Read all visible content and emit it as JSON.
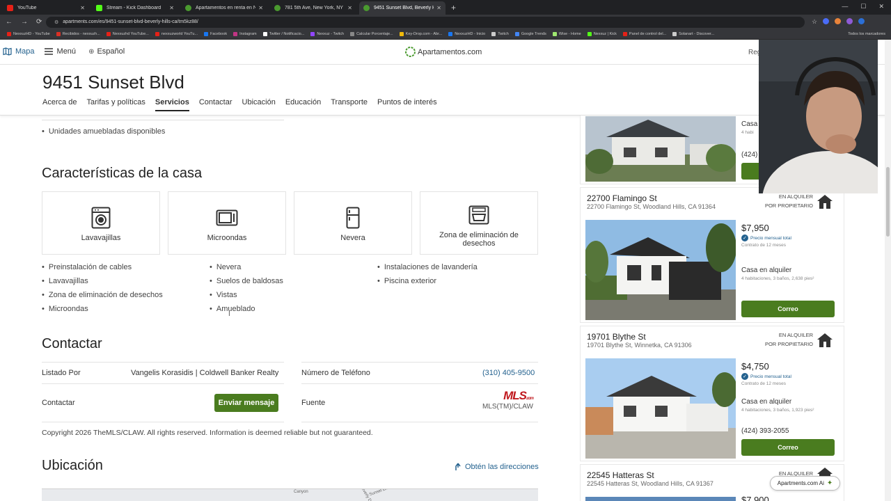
{
  "browser": {
    "tabs": [
      {
        "title": "YouTube",
        "color": "#e62117"
      },
      {
        "title": "Stream - Kick Dashboard",
        "color": "#53fc18"
      },
      {
        "title": "Apartamentos en renta en New",
        "color": "#4a9a2f"
      },
      {
        "title": "781 5th Ave, New York, NY 100",
        "color": "#4a9a2f"
      },
      {
        "title": "9451 Sunset Blvd, Beverly Hills",
        "color": "#4a9a2f",
        "active": true
      }
    ],
    "url": "apartments.com/es/9451-sunset-blvd-beverly-hills-ca/tm5kz88/",
    "bookmarks": [
      {
        "label": "NexxuzHD - YouTube",
        "color": "#e62117"
      },
      {
        "label": "Recibidos - nexxuzh...",
        "color": "#d93025"
      },
      {
        "label": "Nexxuzhd YouTube...",
        "color": "#e62117"
      },
      {
        "label": "nexxuzworld YouTu...",
        "color": "#e62117"
      },
      {
        "label": "Facebook",
        "color": "#1877f2"
      },
      {
        "label": "Instagram",
        "color": "#c13584"
      },
      {
        "label": "Twitter / Notificacio...",
        "color": "#ffffff"
      },
      {
        "label": "Nexxuz - Twitch",
        "color": "#9146ff"
      },
      {
        "label": "Calcular Porcentaje...",
        "color": "#888888"
      },
      {
        "label": "Key-Drop.com - Abr...",
        "color": "#f0b90b"
      },
      {
        "label": "NexxuzHD - Inicio",
        "color": "#1877f2"
      },
      {
        "label": "Twitch",
        "color": "#cccccc"
      },
      {
        "label": "Google Trends",
        "color": "#4285f4"
      },
      {
        "label": "Wise - Home",
        "color": "#9fe870"
      },
      {
        "label": "Nexxuz | Kick",
        "color": "#53fc18"
      },
      {
        "label": "Panel de control del...",
        "color": "#e62117"
      },
      {
        "label": "Solanart - Discover...",
        "color": "#cccccc"
      }
    ],
    "all_bookmarks": "Todos los marcadores"
  },
  "site_header": {
    "map_label": "Mapa",
    "menu_label": "Menú",
    "language_label": "Español",
    "logo_text": "Apartamentos.com",
    "right_text_1": "Reg",
    "right_text_2": "r"
  },
  "property": {
    "title": "9451 Sunset Blvd",
    "tabs": [
      "Acerca de",
      "Tarifas y políticas",
      "Servicios",
      "Contactar",
      "Ubicación",
      "Educación",
      "Transporte",
      "Puntos de interés"
    ],
    "active_tab": "Servicios"
  },
  "main": {
    "furnished_note": "Unidades amuebladas disponibles",
    "features_title": "Características de la casa",
    "feature_cards": [
      {
        "label": "Lavavajillas",
        "icon": "dishwasher-icon"
      },
      {
        "label": "Microondas",
        "icon": "microwave-icon"
      },
      {
        "label": "Nevera",
        "icon": "fridge-icon"
      },
      {
        "label": "Zona de eliminación de desechos",
        "icon": "disposal-icon"
      }
    ],
    "features_list": [
      [
        "Preinstalación de cables",
        "Lavavajillas",
        "Zona de eliminación de desechos",
        "Microondas"
      ],
      [
        "Nevera",
        "Suelos de baldosas",
        "Vistas",
        "Amueblado"
      ],
      [
        "Instalaciones de lavandería",
        "Piscina exterior"
      ]
    ],
    "contact_title": "Contactar",
    "listed_by_label": "Listado Por",
    "listed_by_value": "Vangelis Korasidis | Coldwell Banker Realty",
    "phone_label": "Número de Teléfono",
    "phone_value": "(310) 405-9500",
    "contact_label": "Contactar",
    "send_message": "Enviar mensaje",
    "source_label": "Fuente",
    "source_logo": "MLS",
    "source_logo_sub": ".com",
    "source_value": "MLS(TM)/CLAW",
    "copyright": "Copyright 2026 TheMLS/CLAW. All rights reserved. Information is deemed reliable but not guaranteed.",
    "location_title": "Ubicación",
    "directions": "Obtén las direcciones",
    "map_labels": [
      "Canyon",
      "Sunset Blvd",
      "N Beverly Dr"
    ]
  },
  "listings": [
    {
      "name": "",
      "address": "",
      "type": "Casa",
      "detail": "4 habi",
      "phone": "(424)",
      "button": "Correo"
    },
    {
      "name": "22700 Flamingo St",
      "address": "22700 Flamingo St, Woodland Hills, CA 91364",
      "status1": "EN ALQUILER",
      "status2": "POR PROPIETARIO",
      "price": "$7,950",
      "verified": "Precio mensual total",
      "lease": "Contrato de 12 meses",
      "type": "Casa en alquiler",
      "detail": "4 habitaciones, 3 baños, 2,638 pies²",
      "button": "Correo"
    },
    {
      "name": "19701 Blythe St",
      "address": "19701 Blythe St, Winnetka, CA 91306",
      "status1": "EN ALQUILER",
      "status2": "POR PROPIETARIO",
      "price": "$4,750",
      "verified": "Precio mensual total",
      "lease": "Contrato de 12 meses",
      "type": "Casa en alquiler",
      "detail": "4 habitaciones, 3 baños, 1,923 pies²",
      "phone": "(424) 393-2055",
      "button": "Correo"
    },
    {
      "name": "22545 Hatteras St",
      "address": "22545 Hatteras St, Woodland Hills, CA 91367",
      "status1": "EN ALQUILER",
      "price": "$7,900"
    }
  ],
  "ai_button": "Apartments.com Ai",
  "colors": {
    "accent_green": "#4a7c1f",
    "link_blue": "#23618e",
    "mls_red": "#c0191e"
  }
}
